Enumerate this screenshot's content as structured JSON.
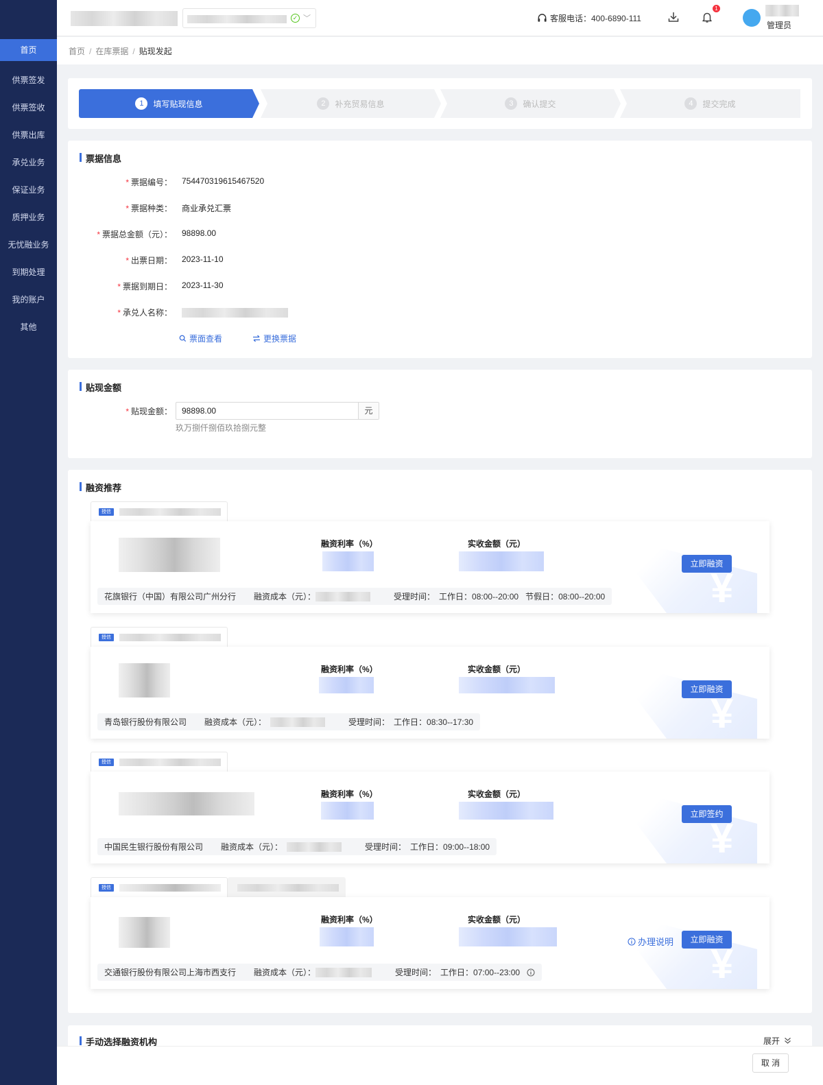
{
  "sidebar": {
    "items": [
      {
        "label": "首页",
        "active": true
      },
      {
        "label": "供票签发"
      },
      {
        "label": "供票签收"
      },
      {
        "label": "供票出库"
      },
      {
        "label": "承兑业务"
      },
      {
        "label": "保证业务"
      },
      {
        "label": "质押业务"
      },
      {
        "label": "无忧融业务"
      },
      {
        "label": "到期处理"
      },
      {
        "label": "我的账户"
      },
      {
        "label": "其他"
      }
    ]
  },
  "header": {
    "phone_label": "客服电话：400-6890-111",
    "notification_count": "1",
    "user_role": "管理员",
    "avatar_color": "#45a8ef",
    "status_icon": "check-circle-icon"
  },
  "breadcrumb": {
    "items": [
      "首页",
      "在库票据",
      "贴现发起"
    ]
  },
  "steps": [
    {
      "num": "1",
      "label": "填写贴现信息",
      "active": true
    },
    {
      "num": "2",
      "label": "补充贸易信息"
    },
    {
      "num": "3",
      "label": "确认提交"
    },
    {
      "num": "4",
      "label": "提交完成"
    }
  ],
  "bill_info": {
    "title": "票据信息",
    "fields": [
      {
        "label": "票据编号：",
        "value": "754470319615467520"
      },
      {
        "label": "票据种类：",
        "value": "商业承兑汇票"
      },
      {
        "label": "票据总金额（元）：",
        "value": "98898.00"
      },
      {
        "label": "出票日期：",
        "value": "2023-11-10"
      },
      {
        "label": "票据到期日：",
        "value": "2023-11-30"
      },
      {
        "label": "承兑人名称：",
        "value": ""
      }
    ],
    "view_link": "票面查看",
    "change_link": "更换票据"
  },
  "discount": {
    "title": "贴现金额",
    "label": "贴现金额：",
    "value": "98898.00",
    "unit": "元",
    "amount_cn": "玖万捌仟捌佰玖拾捌元整"
  },
  "finance": {
    "title": "融资推荐",
    "tag": "授信",
    "rate_label": "融资利率（%）",
    "amount_label": "实收金额（元）",
    "cost_label": "融资成本（元）：",
    "time_label": "受理时间：",
    "cards": [
      {
        "bank": "花旗银行（中国）有限公司广州分行",
        "time": "工作日：08:00--20:00",
        "time2": "节假日：08:00--20:00",
        "button": "立即融资"
      },
      {
        "bank": "青岛银行股份有限公司",
        "time": "工作日：08:30--17:30",
        "button": "立即融资"
      },
      {
        "bank": "中国民生银行股份有限公司",
        "time": "工作日：09:00--18:00",
        "button": "立即签约"
      },
      {
        "bank": "交通银行股份有限公司上海市西支行",
        "time": "工作日：07:00--23:00",
        "button": "立即融资",
        "howto": "办理说明"
      }
    ]
  },
  "manual": {
    "title": "手动选择融资机构",
    "expand": "展开"
  },
  "footer": {
    "cancel": "取 消"
  }
}
